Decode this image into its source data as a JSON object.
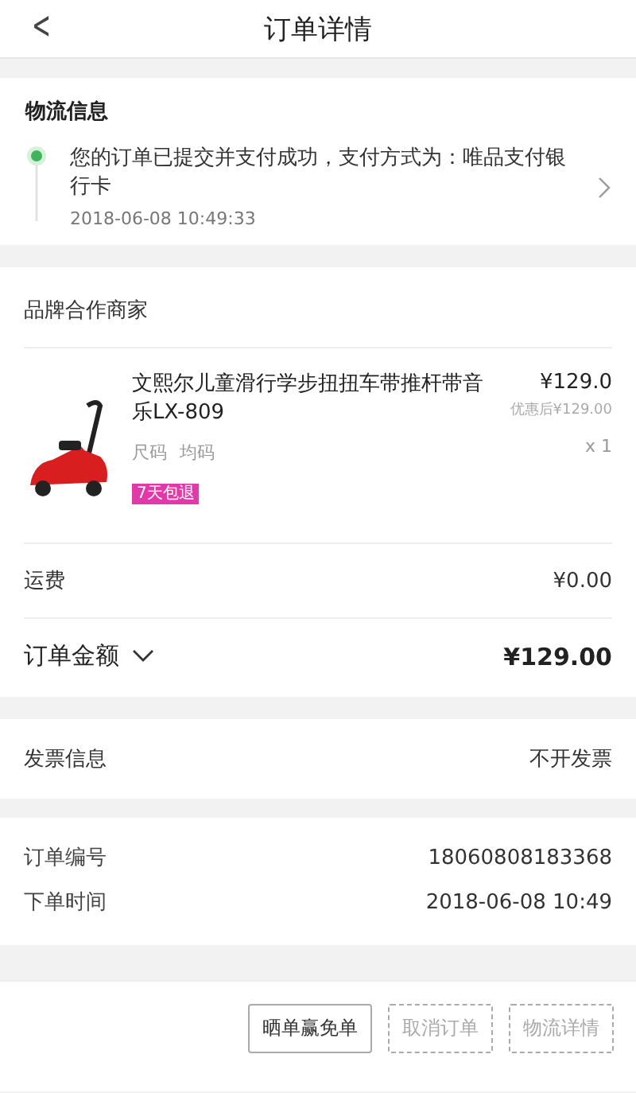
{
  "header": {
    "back": "<",
    "title": "订单详情"
  },
  "logistics": {
    "title": "物流信息",
    "message": "您的订单已提交并支付成功，支付方式为：唯品支付银行卡",
    "time": "2018-06-08 10:49:33"
  },
  "merchant": {
    "title": "品牌合作商家",
    "product": {
      "name": "文熙尔儿童滑行学步扭扭车带推杆带音乐LX-809",
      "spec_label": "尺码",
      "spec_value": "均码",
      "badge": "7天包退",
      "price": "¥129.0",
      "discount": "优惠后¥129.00",
      "quantity": "x 1"
    }
  },
  "shipping": {
    "label": "运费",
    "value": "¥0.00"
  },
  "total": {
    "label": "订单金额",
    "expanded": false,
    "value": "¥129.00"
  },
  "invoice": {
    "label": "发票信息",
    "value": "不开发票"
  },
  "order_info": [
    {
      "label": "订单编号",
      "value": "18060808183368"
    },
    {
      "label": "下单时间",
      "value": "2018-06-08 10:49"
    }
  ],
  "buttons": [
    {
      "label": "晒单赢免单",
      "disabled": false
    },
    {
      "label": "取消订单",
      "disabled": true
    },
    {
      "label": "物流详情",
      "disabled": true
    }
  ]
}
